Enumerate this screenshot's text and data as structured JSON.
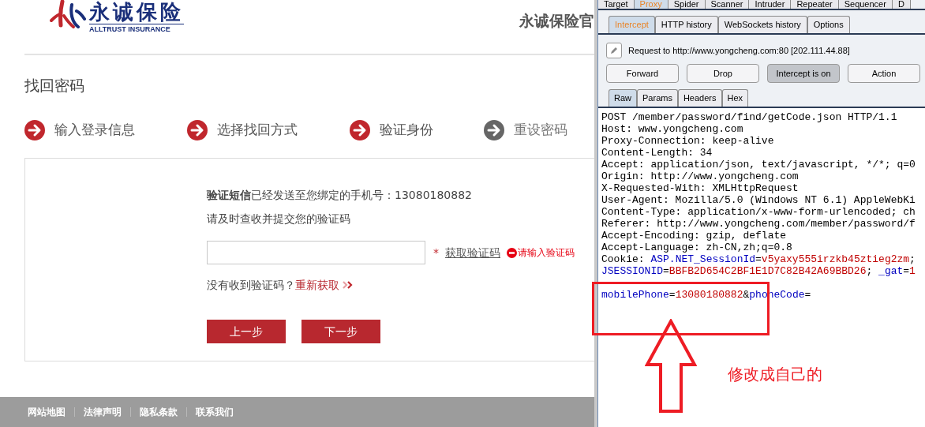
{
  "site": {
    "logo_name": "永诚保险",
    "logo_subtitle": "ALLTRUST INSURANCE",
    "header_title": "永诚保险官",
    "page_title": "找回密码",
    "steps": [
      {
        "label": "输入登录信息",
        "done": true
      },
      {
        "label": "选择找回方式",
        "done": true
      },
      {
        "label": "验证身份",
        "done": true
      },
      {
        "label": "重设密码",
        "done": false
      }
    ],
    "notice": "**验证短信**已经发送至您绑定的手机号：13080180882",
    "hint": "请及时查收并提交您的验证码",
    "code_field": {
      "required_mark": "*",
      "link": "获取验证码",
      "error": "请输入验证码"
    },
    "resend": {
      "question": "没有收到验证码？",
      "link": "重新获取"
    },
    "buttons": [
      "上一步",
      "下一步"
    ],
    "footer_links": [
      "网站地图",
      "法律声明",
      "隐私条款",
      "联系我们"
    ]
  },
  "burp": {
    "tools": [
      {
        "label": "Target",
        "selected": false
      },
      {
        "label": "Proxy",
        "selected": true
      },
      {
        "label": "Spider",
        "selected": false
      },
      {
        "label": "Scanner",
        "selected": false
      },
      {
        "label": "Intruder",
        "selected": false
      },
      {
        "label": "Repeater",
        "selected": false
      },
      {
        "label": "Sequencer",
        "selected": false
      },
      {
        "label": "D",
        "selected": false
      }
    ],
    "proxy_tabs": [
      {
        "label": "Intercept",
        "selected": true
      },
      {
        "label": "HTTP history",
        "selected": false
      },
      {
        "label": "WebSockets history",
        "selected": false
      },
      {
        "label": "Options",
        "selected": false
      }
    ],
    "request_info": "Request to http://www.yongcheng.com:80  [202.111.44.88]",
    "actions": [
      {
        "label": "Forward",
        "pressed": false
      },
      {
        "label": "Drop",
        "pressed": false
      },
      {
        "label": "Intercept is on",
        "pressed": true
      },
      {
        "label": "Action",
        "pressed": false
      }
    ],
    "view_tabs": [
      {
        "label": "Raw",
        "selected": true
      },
      {
        "label": "Params",
        "selected": false
      },
      {
        "label": "Headers",
        "selected": false
      },
      {
        "label": "Hex",
        "selected": false
      }
    ],
    "lines": [
      {
        "kind": "header",
        "segments": [
          {
            "text": "POST /member/password/find/getCode.json HTTP/1.1",
            "kind": "plain"
          }
        ]
      },
      {
        "kind": "header",
        "segments": [
          {
            "text": "Host: www.yongcheng.com",
            "kind": "plain"
          }
        ]
      },
      {
        "kind": "header",
        "segments": [
          {
            "text": "Proxy-Connection: keep-alive",
            "kind": "plain"
          }
        ]
      },
      {
        "kind": "header",
        "segments": [
          {
            "text": "Content-Length: 34",
            "kind": "plain"
          }
        ]
      },
      {
        "kind": "header",
        "segments": [
          {
            "text": "Accept: application/json, text/javascript, */*; q=0",
            "kind": "plain"
          }
        ]
      },
      {
        "kind": "header",
        "segments": [
          {
            "text": "Origin: http://www.yongcheng.com",
            "kind": "plain"
          }
        ]
      },
      {
        "kind": "header",
        "segments": [
          {
            "text": "X-Requested-With: XMLHttpRequest",
            "kind": "plain"
          }
        ]
      },
      {
        "kind": "header",
        "segments": [
          {
            "text": "User-Agent: Mozilla/5.0 (Windows NT 6.1) AppleWebKi",
            "kind": "plain"
          }
        ]
      },
      {
        "kind": "header",
        "segments": [
          {
            "text": "Content-Type: application/x-www-form-urlencoded; ch",
            "kind": "plain"
          }
        ]
      },
      {
        "kind": "header",
        "segments": [
          {
            "text": "Referer: http://www.yongcheng.com/member/password/f",
            "kind": "plain"
          }
        ]
      },
      {
        "kind": "header",
        "segments": [
          {
            "text": "Accept-Encoding: gzip, deflate",
            "kind": "plain"
          }
        ]
      },
      {
        "kind": "header",
        "segments": [
          {
            "text": "Accept-Language: zh-CN,zh;q=0.8",
            "kind": "plain"
          }
        ]
      },
      {
        "kind": "header",
        "segments": [
          {
            "text": "Cookie: ",
            "kind": "plain"
          },
          {
            "text": "ASP.NET_SessionId",
            "kind": "name"
          },
          {
            "text": "=",
            "kind": "plain"
          },
          {
            "text": "v5yaxy555irzkb45ztieg2zm",
            "kind": "value"
          },
          {
            "text": ";",
            "kind": "plain"
          }
        ]
      },
      {
        "kind": "header",
        "segments": [
          {
            "text": "JSESSIONID",
            "kind": "name"
          },
          {
            "text": "=",
            "kind": "plain"
          },
          {
            "text": "BBFB2D654C2BF1E1D7C82B42A69BBD26",
            "kind": "value"
          },
          {
            "text": "; ",
            "kind": "plain"
          },
          {
            "text": "_gat",
            "kind": "name"
          },
          {
            "text": "=",
            "kind": "plain"
          },
          {
            "text": "1",
            "kind": "value"
          }
        ]
      },
      {
        "kind": "body",
        "segments": [
          {
            "text": "mobilePhone",
            "kind": "name"
          },
          {
            "text": "=",
            "kind": "plain"
          },
          {
            "text": "13080180882",
            "kind": "value"
          },
          {
            "text": "&",
            "kind": "plain"
          },
          {
            "text": "phoneCode",
            "kind": "name"
          },
          {
            "text": "=",
            "kind": "plain"
          }
        ]
      }
    ]
  },
  "annotation": {
    "note": "修改成自己的"
  }
}
